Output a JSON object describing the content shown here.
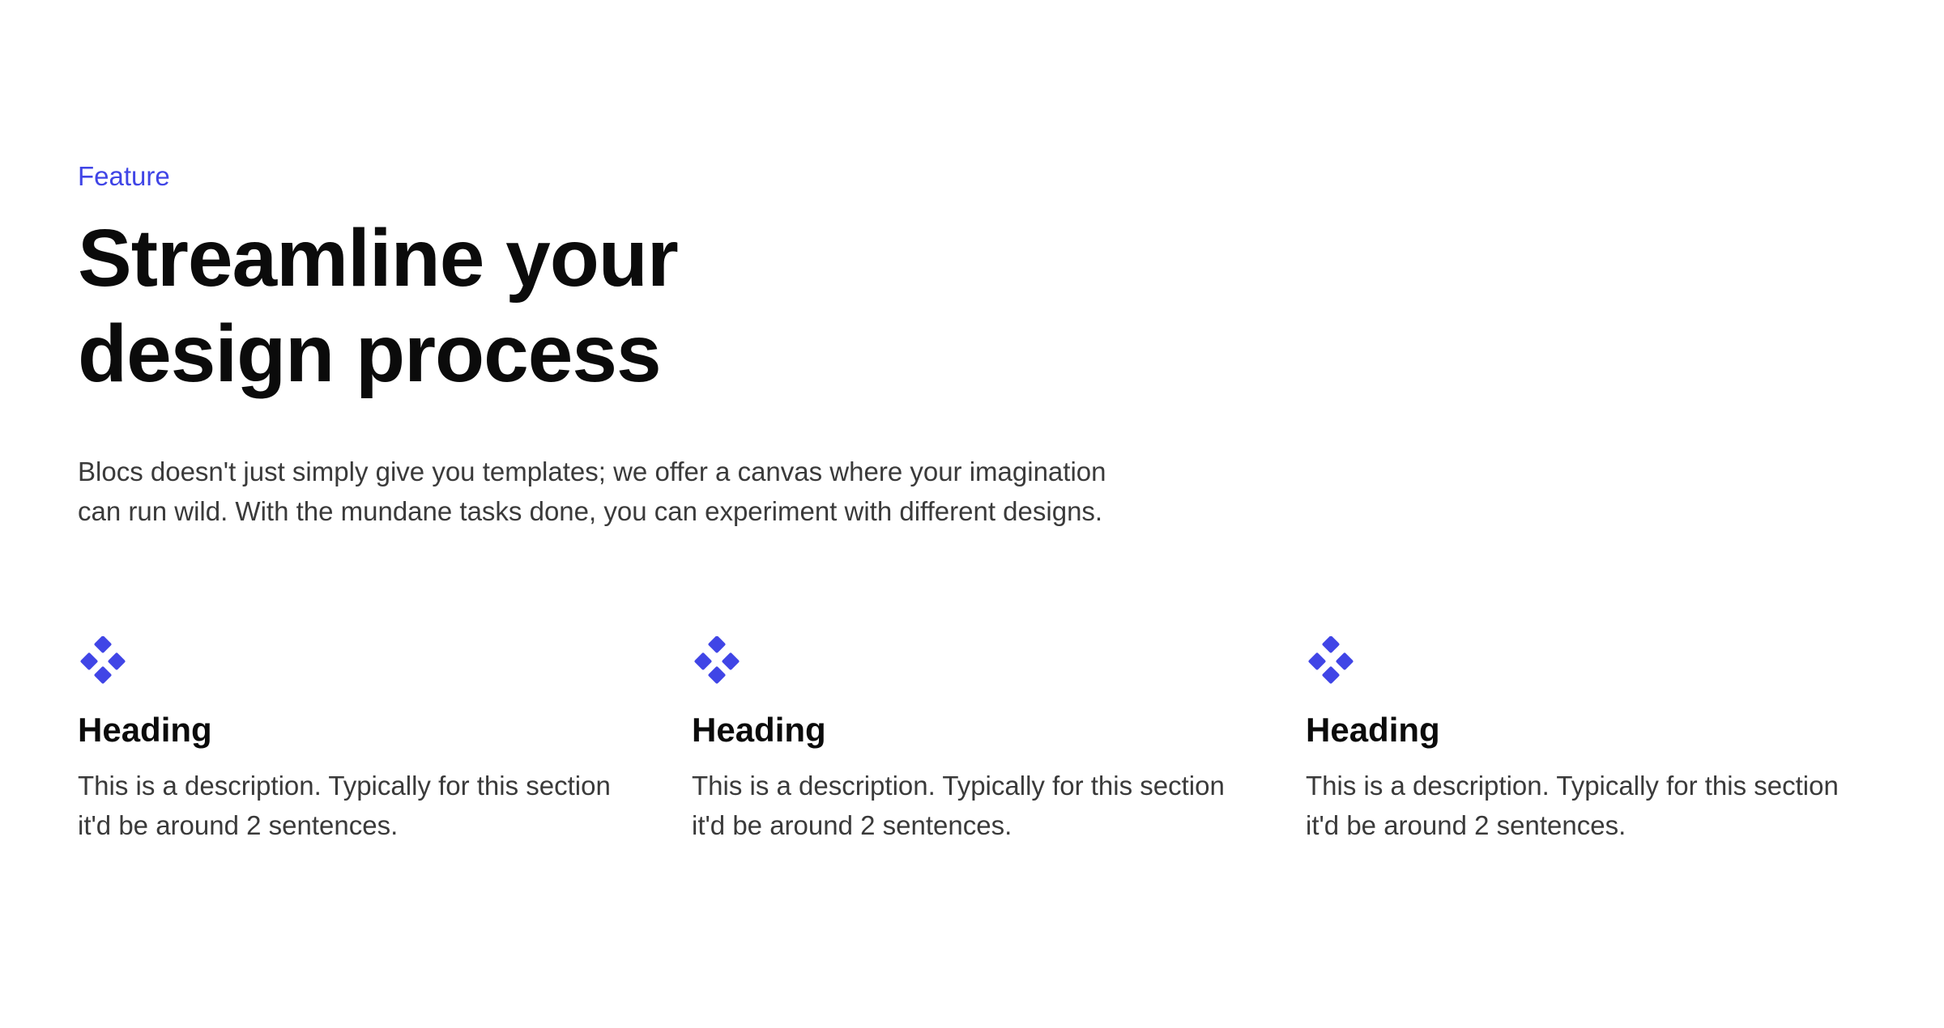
{
  "hero": {
    "eyebrow": "Feature",
    "title_line1": "Streamline your",
    "title_line2": "design process",
    "lead": "Blocs doesn't just simply give you templates; we offer a canvas where your imagination can run wild. With the mundane tasks done, you can experiment with different designs."
  },
  "features": [
    {
      "icon": "diamond-cluster-icon",
      "heading": "Heading",
      "description": "This is a description. Typically for this section it'd be around 2 sentences."
    },
    {
      "icon": "diamond-cluster-icon",
      "heading": "Heading",
      "description": "This is a description. Typically for this section it'd be around 2 sentences."
    },
    {
      "icon": "diamond-cluster-icon",
      "heading": "Heading",
      "description": "This is a description. Typically for this section it'd be around 2 sentences."
    }
  ],
  "colors": {
    "accent": "#4045e6",
    "heading": "#0b0b0b",
    "body": "#3a3a3a",
    "background": "#ffffff"
  }
}
